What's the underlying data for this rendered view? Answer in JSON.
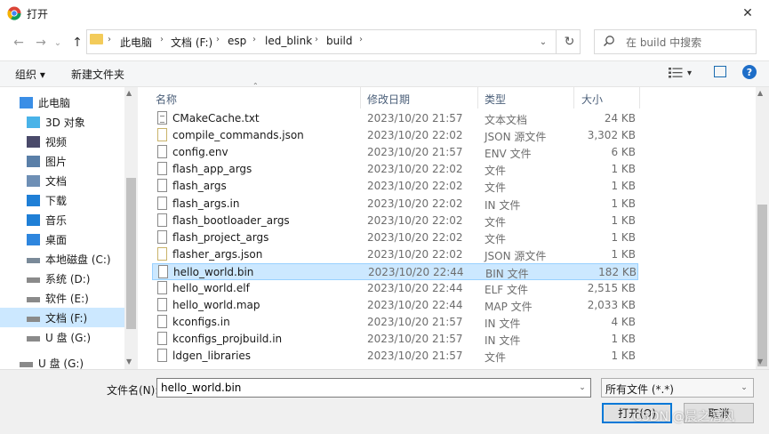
{
  "window": {
    "title": "打开",
    "close_glyph": "✕"
  },
  "nav": {
    "back_glyph": "←",
    "forward_glyph": "→",
    "recent_glyph": "⌄",
    "up_glyph": "↑",
    "refresh_glyph": "↻",
    "address_dropdown_glyph": "⌄",
    "breadcrumbs": [
      "此电脑",
      "文档 (F:)",
      "esp",
      "led_blink",
      "build"
    ],
    "separator": "›"
  },
  "search": {
    "placeholder": "在 build 中搜索"
  },
  "toolbar": {
    "organize_label": "组织 ▾",
    "new_folder_label": "新建文件夹",
    "view_dropdown_glyph": "▾",
    "help_label": "?"
  },
  "sidebar": {
    "items": [
      {
        "label": "此电脑",
        "icon": "computer-icon"
      },
      {
        "label": "3D 对象",
        "icon": "3d-objects-icon"
      },
      {
        "label": "视频",
        "icon": "video-icon"
      },
      {
        "label": "图片",
        "icon": "pictures-icon"
      },
      {
        "label": "文档",
        "icon": "documents-icon"
      },
      {
        "label": "下载",
        "icon": "download-icon"
      },
      {
        "label": "音乐",
        "icon": "music-icon"
      },
      {
        "label": "桌面",
        "icon": "desktop-icon"
      },
      {
        "label": "本地磁盘 (C:)",
        "icon": "windows-drive-icon"
      },
      {
        "label": "系统 (D:)",
        "icon": "drive-icon"
      },
      {
        "label": "软件 (E:)",
        "icon": "drive-icon"
      },
      {
        "label": "文档 (F:)",
        "icon": "drive-icon",
        "selected": true
      },
      {
        "label": "U 盘 (G:)",
        "icon": "usb-drive-icon"
      },
      {
        "label": "U 盘 (G:)",
        "icon": "usb-drive-icon"
      }
    ],
    "scroll_up_glyph": "▲",
    "scroll_down_glyph": "▼"
  },
  "list": {
    "columns": {
      "name": "名称",
      "modified": "修改日期",
      "type": "类型",
      "size": "大小"
    },
    "sort_glyph": "⌃",
    "rows": [
      {
        "name": "CMakeCache.txt",
        "modified": "2023/10/20 21:57",
        "type": "文本文档",
        "size": "24 KB",
        "icon": "txt"
      },
      {
        "name": "compile_commands.json",
        "modified": "2023/10/20 22:02",
        "type": "JSON 源文件",
        "size": "3,302 KB",
        "icon": "json"
      },
      {
        "name": "config.env",
        "modified": "2023/10/20 21:57",
        "type": "ENV 文件",
        "size": "6 KB",
        "icon": "file"
      },
      {
        "name": "flash_app_args",
        "modified": "2023/10/20 22:02",
        "type": "文件",
        "size": "1 KB",
        "icon": "file"
      },
      {
        "name": "flash_args",
        "modified": "2023/10/20 22:02",
        "type": "文件",
        "size": "1 KB",
        "icon": "file"
      },
      {
        "name": "flash_args.in",
        "modified": "2023/10/20 22:02",
        "type": "IN 文件",
        "size": "1 KB",
        "icon": "file"
      },
      {
        "name": "flash_bootloader_args",
        "modified": "2023/10/20 22:02",
        "type": "文件",
        "size": "1 KB",
        "icon": "file"
      },
      {
        "name": "flash_project_args",
        "modified": "2023/10/20 22:02",
        "type": "文件",
        "size": "1 KB",
        "icon": "file"
      },
      {
        "name": "flasher_args.json",
        "modified": "2023/10/20 22:02",
        "type": "JSON 源文件",
        "size": "1 KB",
        "icon": "json"
      },
      {
        "name": "hello_world.bin",
        "modified": "2023/10/20 22:44",
        "type": "BIN 文件",
        "size": "182 KB",
        "icon": "file",
        "selected": true
      },
      {
        "name": "hello_world.elf",
        "modified": "2023/10/20 22:44",
        "type": "ELF 文件",
        "size": "2,515 KB",
        "icon": "file"
      },
      {
        "name": "hello_world.map",
        "modified": "2023/10/20 22:44",
        "type": "MAP 文件",
        "size": "2,033 KB",
        "icon": "file"
      },
      {
        "name": "kconfigs.in",
        "modified": "2023/10/20 21:57",
        "type": "IN 文件",
        "size": "4 KB",
        "icon": "file"
      },
      {
        "name": "kconfigs_projbuild.in",
        "modified": "2023/10/20 21:57",
        "type": "IN 文件",
        "size": "1 KB",
        "icon": "file"
      },
      {
        "name": "ldgen_libraries",
        "modified": "2023/10/20 21:57",
        "type": "文件",
        "size": "1 KB",
        "icon": "file"
      }
    ],
    "scroll_up_glyph": "▲",
    "scroll_down_glyph": "▼"
  },
  "footer": {
    "filename_label": "文件名(N):",
    "filename_value": "hello_world.bin",
    "filetype_value": "所有文件 (*.*)",
    "dropdown_glyph": "⌄",
    "open_label": "打开(O)",
    "cancel_label": "取消"
  },
  "watermark": "CSDN @晨之清风",
  "colors": {
    "accent": "#0078d7",
    "selection": "#cce8ff",
    "header_text": "#4c607a"
  }
}
